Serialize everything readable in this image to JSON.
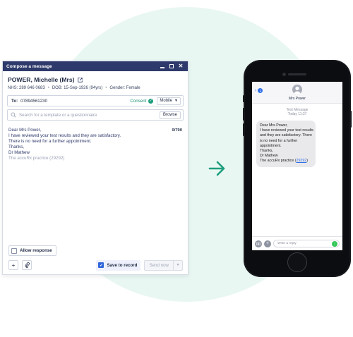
{
  "compose": {
    "title": "Compose a message",
    "patient": {
      "name": "POWER, Michelle (Mrs)",
      "nhs": "NHS: 289 646 0683",
      "dob": "DOB: 15-Sep-1926 (94yrs)",
      "gender": "Gender: Female"
    },
    "to": {
      "label": "To:",
      "number": "07894561230",
      "consent": "Consent",
      "device": "Mobile"
    },
    "search": {
      "placeholder": "Search for a template or a questionnaire",
      "browse": "Browse"
    },
    "message": {
      "counter": "0/700",
      "lines": [
        "Dear Mrs Power,",
        "I have reviewed your test results and they are satisfactory.",
        "There is no need for a further appointment.",
        "Thanks,",
        "Dr Mathew",
        "The accuRx practice (29292)"
      ]
    },
    "allow_response": "Allow response",
    "save_to_record": "Save to record",
    "send_now": "Send now"
  },
  "phone": {
    "back_count": "1",
    "contact_name": "Mrs Power",
    "meta_type": "Text Message",
    "meta_time": "Today 11:37",
    "bubble": {
      "lines": [
        "Dear Mrs Power,",
        "I have reviewed your test results",
        "and they are satisfactory. There",
        "is no need for a further",
        "appointment.",
        "Thanks,",
        "Dr Mathew"
      ],
      "last_prefix": "The accuRx practice (",
      "last_link": "29292",
      "last_suffix": ")"
    },
    "reply_placeholder": "Write a reply"
  },
  "colors": {
    "titlebar": "#2e3a6b",
    "accent_green": "#1e9e7e",
    "check_blue": "#2f66d9",
    "ios_blue": "#2f6fe8",
    "ios_send": "#34c759",
    "bg_circle": "#e9f7f3"
  }
}
